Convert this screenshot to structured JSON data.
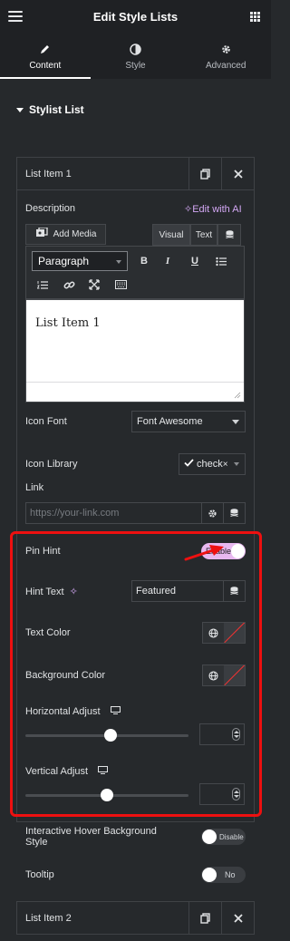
{
  "header": {
    "title": "Edit Style Lists"
  },
  "tabs": [
    {
      "label": "Content",
      "icon": "pencil-icon"
    },
    {
      "label": "Style",
      "icon": "half-circle-icon"
    },
    {
      "label": "Advanced",
      "icon": "gear-icon"
    }
  ],
  "section": {
    "title": "Stylist List"
  },
  "item1": {
    "title": "List Item 1",
    "description_label": "Description",
    "edit_ai_label": "Edit with AI",
    "add_media_label": "Add Media",
    "visual_tab": "Visual",
    "text_tab": "Text",
    "paragraph_select": "Paragraph",
    "editor_content": "List Item 1",
    "icon_font_label": "Icon Font",
    "icon_font_value": "Font Awesome",
    "icon_library_label": "Icon Library",
    "icon_library_value": "check",
    "link_label": "Link",
    "link_placeholder": "https://your-link.com",
    "pin_hint_label": "Pin Hint",
    "pin_hint_toggle": "Enable",
    "pin_hint_on": true,
    "hint_text_label": "Hint Text",
    "hint_text_value": "Featured",
    "text_color_label": "Text Color",
    "bg_color_label": "Background Color",
    "h_adjust_label": "Horizontal Adjust",
    "h_adjust_level": 0.52,
    "v_adjust_label": "Vertical Adjust",
    "v_adjust_level": 0.5,
    "hover_bg_label": "Interactive Hover Background Style",
    "hover_bg_toggle": "Disable",
    "tooltip_label": "Tooltip",
    "tooltip_toggle": "No"
  },
  "item2": {
    "title": "List Item 2"
  },
  "colors": {
    "accent_ai": "#d4a8f5",
    "toggle_on": "#e8b8f0",
    "annotation": "#ee1010"
  }
}
